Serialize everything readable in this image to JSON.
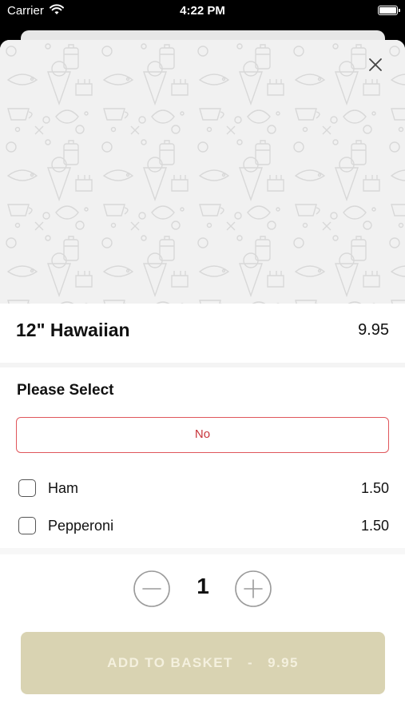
{
  "status_bar": {
    "carrier": "Carrier",
    "time": "4:22 PM"
  },
  "product": {
    "name": "12\" Hawaiian",
    "price": "9.95"
  },
  "options_section": {
    "title": "Please Select",
    "selected_choice": "No",
    "extras": [
      {
        "label": "Ham",
        "price": "1.50",
        "checked": false
      },
      {
        "label": "Pepperoni",
        "price": "1.50",
        "checked": false
      }
    ]
  },
  "quantity": {
    "value": "1"
  },
  "add_button": {
    "label": "ADD TO BASKET",
    "separator": "-",
    "price": "9.95"
  },
  "colors": {
    "accent_red": "#e0565b",
    "add_button_bg": "#d9d3b2",
    "hero_bg": "#f1f1f1"
  },
  "icons": {
    "close": "close-icon",
    "minus": "minus-circle-icon",
    "plus": "plus-circle-icon",
    "wifi": "wifi-icon",
    "battery": "battery-icon"
  }
}
